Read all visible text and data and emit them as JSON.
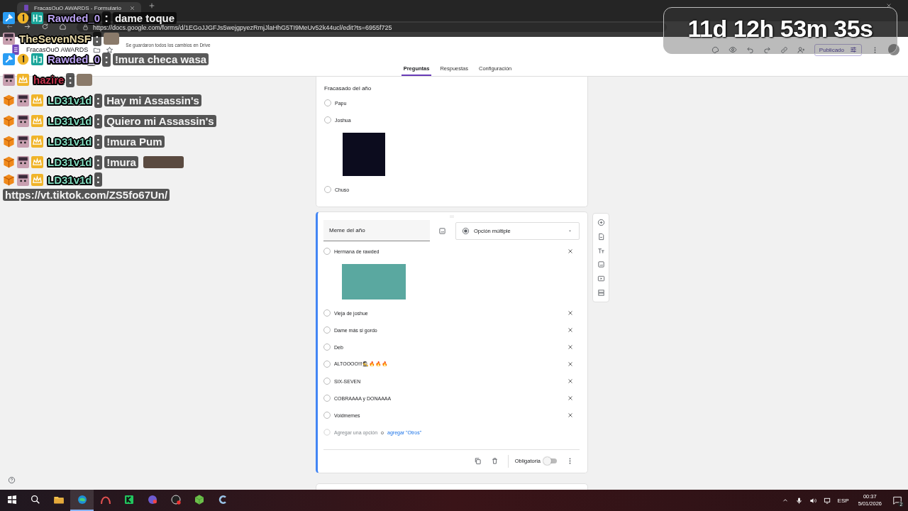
{
  "browser": {
    "tab_title": "FracasOuO AWARDS - Formulario",
    "url": "https://docs.google.com/forms/d/1EGoJJGFJs5wejgpyezRmjJlaHhG5TI9MeUv52k44ucl/edit?ts=6955f725"
  },
  "form_header": {
    "title": "FracasOuO AWARDS",
    "save_status": "Se guardaron todos los cambios en Drive",
    "publish_button": "Publicado",
    "tabs": [
      {
        "label": "Preguntas",
        "selected": true
      },
      {
        "label": "Respuestas",
        "selected": false
      },
      {
        "label": "Configuración",
        "selected": false
      }
    ]
  },
  "questions": [
    {
      "title": "Fracasado del año",
      "active": false,
      "options": [
        {
          "label": "Papu",
          "image": false,
          "selected": false
        },
        {
          "label": "Joshua",
          "image": true,
          "selected": false
        },
        {
          "label": "Chuso",
          "image": false,
          "selected": false
        }
      ]
    },
    {
      "title": "Meme del año",
      "active": true,
      "type": "Opción múltiple",
      "add_option": "Agregar una opción",
      "or": "o",
      "add_other": "agregar \"Otros\"",
      "required_label": "Obligatoria",
      "required": false,
      "options": [
        {
          "label": "Hermana de rawded",
          "image": true,
          "selected": false
        },
        {
          "label": "Vieja de joshue",
          "image": false,
          "selected": false
        },
        {
          "label": "Dame más si gordo",
          "image": false,
          "selected": false
        },
        {
          "label": "Deb",
          "image": false,
          "selected": false
        },
        {
          "label": "ALTOOOO!!!🕵️🔥🔥🔥",
          "image": false,
          "selected": false
        },
        {
          "label": "SIX-SEVEN",
          "image": false,
          "selected": false
        },
        {
          "label": "COBRAAAA y DONAAAA",
          "image": false,
          "selected": false
        },
        {
          "label": "Voidmemes",
          "image": false,
          "selected": false
        }
      ]
    }
  ],
  "chat": [
    {
      "badges": [
        {
          "kind": "wrench"
        },
        {
          "kind": "coin"
        },
        {
          "kind": "glyph"
        }
      ],
      "user": "Rawded_0",
      "color": "#b9a0f0",
      "separator": ":",
      "message": "dame toque",
      "emote": false
    },
    {
      "badges": [
        {
          "kind": "face"
        }
      ],
      "user": "TheSevenNSF",
      "color": "#e8d9a8",
      "separator": ":",
      "emote": true
    },
    {
      "badges": [
        {
          "kind": "wrench"
        },
        {
          "kind": "coin"
        },
        {
          "kind": "glyph"
        }
      ],
      "user": "Rawded_0",
      "color": "#b9a0f0",
      "separator": ":",
      "message": "!mura checa wasa",
      "emote": false
    },
    {
      "badges": [
        {
          "kind": "face"
        },
        {
          "kind": "crown"
        }
      ],
      "user": "hazire",
      "color": "#c0304a",
      "separator": ":",
      "emote": true
    },
    {
      "badges": [
        {
          "kind": "cube"
        },
        {
          "kind": "face"
        },
        {
          "kind": "crown"
        }
      ],
      "user": "LD31v1d",
      "color": "#7fd8bc",
      "separator": ":",
      "message": "Hay mi Assassin's",
      "emote": false
    },
    {
      "badges": [
        {
          "kind": "cube"
        },
        {
          "kind": "face"
        },
        {
          "kind": "crown"
        }
      ],
      "user": "LD31v1d",
      "color": "#7fd8bc",
      "separator": ":",
      "message": "Quiero mi Assassin's",
      "emote": false
    },
    {
      "badges": [
        {
          "kind": "cube"
        },
        {
          "kind": "face"
        },
        {
          "kind": "crown"
        }
      ],
      "user": "LD31v1d",
      "color": "#7fd8bc",
      "separator": ":",
      "message": "!mura Pum",
      "emote": false
    },
    {
      "badges": [
        {
          "kind": "cube"
        },
        {
          "kind": "face"
        },
        {
          "kind": "crown"
        }
      ],
      "user": "LD31v1d",
      "color": "#7fd8bc",
      "separator": ":",
      "message": "!mura",
      "emote": true
    },
    {
      "badges": [
        {
          "kind": "cube"
        },
        {
          "kind": "face"
        },
        {
          "kind": "crown"
        }
      ],
      "user": "LD31v1d",
      "color": "#7fd8bc",
      "separator": ":",
      "message": "https://vt.tiktok.com/ZS5fo67Un/",
      "emote": false
    }
  ],
  "timer": "11d 12h 53m 35s",
  "taskbar": {
    "apps": [
      {
        "kind": "start",
        "active": false
      },
      {
        "kind": "search",
        "active": false
      },
      {
        "kind": "folder",
        "active": false
      },
      {
        "kind": "browser",
        "active": true
      },
      {
        "kind": "arc",
        "active": false
      },
      {
        "kind": "green",
        "active": false
      },
      {
        "kind": "chat",
        "active": false
      },
      {
        "kind": "record",
        "active": false
      },
      {
        "kind": "cube",
        "active": false
      },
      {
        "kind": "c",
        "active": false
      }
    ],
    "language": "ESP",
    "time": "00:37",
    "date": "5/01/2026",
    "notifications": "2"
  }
}
